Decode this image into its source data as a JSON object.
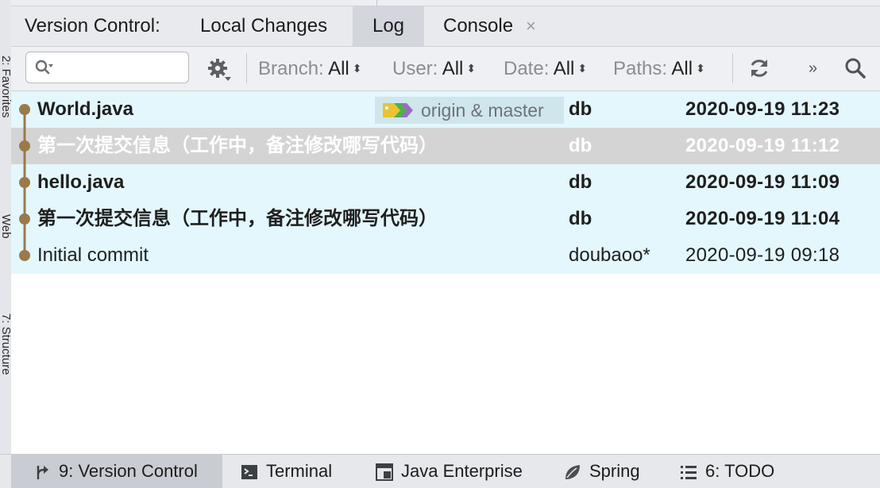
{
  "left_strip": {
    "labels": [
      "2: Favorites",
      "7: Structure",
      "Web"
    ]
  },
  "tabs": {
    "title": "Version Control:",
    "items": [
      {
        "label": "Local Changes"
      },
      {
        "label": "Log",
        "active": true
      },
      {
        "label": "Console",
        "closable": true
      }
    ],
    "close_glyph": "×"
  },
  "toolbar": {
    "search": {
      "value": "",
      "placeholder": ""
    },
    "filters": [
      {
        "label": "Branch:",
        "value": "All"
      },
      {
        "label": "User:",
        "value": "All"
      },
      {
        "label": "Date:",
        "value": "All"
      },
      {
        "label": "Paths:",
        "value": "All"
      }
    ],
    "arrow_glyph": "⬍",
    "more_glyph": "»",
    "icons": [
      "search-dropdown-icon",
      "gear-icon",
      "refresh-icon",
      "more-icon",
      "search-icon"
    ]
  },
  "commits": [
    {
      "message": "World.java",
      "refs": "origin & master",
      "author": "db",
      "date": "2020-09-19 11:23",
      "bold": true,
      "selected": false
    },
    {
      "message": "第一次提交信息（工作中，备注修改哪写代码）",
      "refs": "",
      "author": "db",
      "date": "2020-09-19 11:12",
      "bold": true,
      "selected": true
    },
    {
      "message": "hello.java",
      "refs": "",
      "author": "db",
      "date": "2020-09-19 11:09",
      "bold": true,
      "selected": false
    },
    {
      "message": "第一次提交信息（工作中，备注修改哪写代码）",
      "refs": "",
      "author": "db",
      "date": "2020-09-19 11:04",
      "bold": true,
      "selected": false
    },
    {
      "message": "Initial commit",
      "refs": "",
      "author": "doubaoo*",
      "date": "2020-09-19 09:18",
      "bold": false,
      "selected": false
    }
  ],
  "colors": {
    "row_background": "#e3f7fd",
    "selected_row": "#d4d4d4",
    "graph_line": "#9a7a4a",
    "ref_tag_yellow": "#e8c435",
    "ref_tag_green": "#4fb04f",
    "ref_tag_purple": "#9b6bc6"
  },
  "bottom_bar": {
    "items": [
      {
        "label": "9: Version Control",
        "icon": "vcs-icon",
        "active": true
      },
      {
        "label": "Terminal",
        "icon": "terminal-icon"
      },
      {
        "label": "Java Enterprise",
        "icon": "java-enterprise-icon"
      },
      {
        "label": "Spring",
        "icon": "spring-leaf-icon"
      },
      {
        "label": "6: TODO",
        "icon": "todo-list-icon"
      }
    ]
  }
}
